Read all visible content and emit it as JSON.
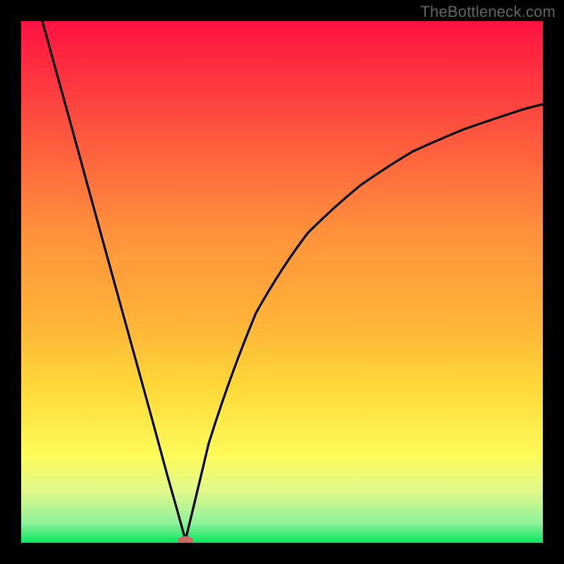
{
  "watermark": "TheBottleneck.com",
  "colors": {
    "frame": "#000000",
    "gradient_top": "#fe1242",
    "gradient_mid1": "#ff903c",
    "gradient_mid2": "#ffd83a",
    "gradient_mid3": "#fefb59",
    "gradient_mid4": "#e1f88a",
    "gradient_bottom": "#07e65e",
    "curve": "#000000",
    "marker": "#cc6861"
  },
  "chart_data": {
    "type": "line",
    "title": "",
    "xlabel": "",
    "ylabel": "",
    "xlim": [
      0,
      100
    ],
    "ylim": [
      0,
      100
    ],
    "left_branch": {
      "description": "steep near-linear descent from top-left edge toward the minimum",
      "x": [
        4.1,
        10,
        15,
        20,
        25,
        28,
        30,
        31.5
      ],
      "y": [
        100,
        78.5,
        60.3,
        42.2,
        24.0,
        13.1,
        5.9,
        0.5
      ]
    },
    "right_branch": {
      "description": "asymptotic rise from the minimum toward ~84% at right edge",
      "x": [
        31.5,
        33,
        36,
        40,
        45,
        50,
        55,
        60,
        65,
        70,
        75,
        80,
        85,
        90,
        95,
        100
      ],
      "y": [
        0.5,
        6.0,
        19.0,
        32.0,
        44.0,
        53.0,
        59.5,
        64.5,
        68.5,
        72.0,
        74.8,
        77.2,
        79.3,
        81.0,
        82.6,
        84.0
      ]
    },
    "marker": {
      "x": 31.5,
      "y": 0.4,
      "shape": "oval",
      "color": "#cc6861"
    },
    "gradient_stops_pct": [
      0,
      40,
      58,
      70,
      83,
      90,
      96.2,
      100
    ],
    "gradient_colors": [
      "#fe1242",
      "#ff903c",
      "#ffb438",
      "#ffd83a",
      "#fefb59",
      "#e1f88a",
      "#8ff19c",
      "#07e65e"
    ]
  }
}
